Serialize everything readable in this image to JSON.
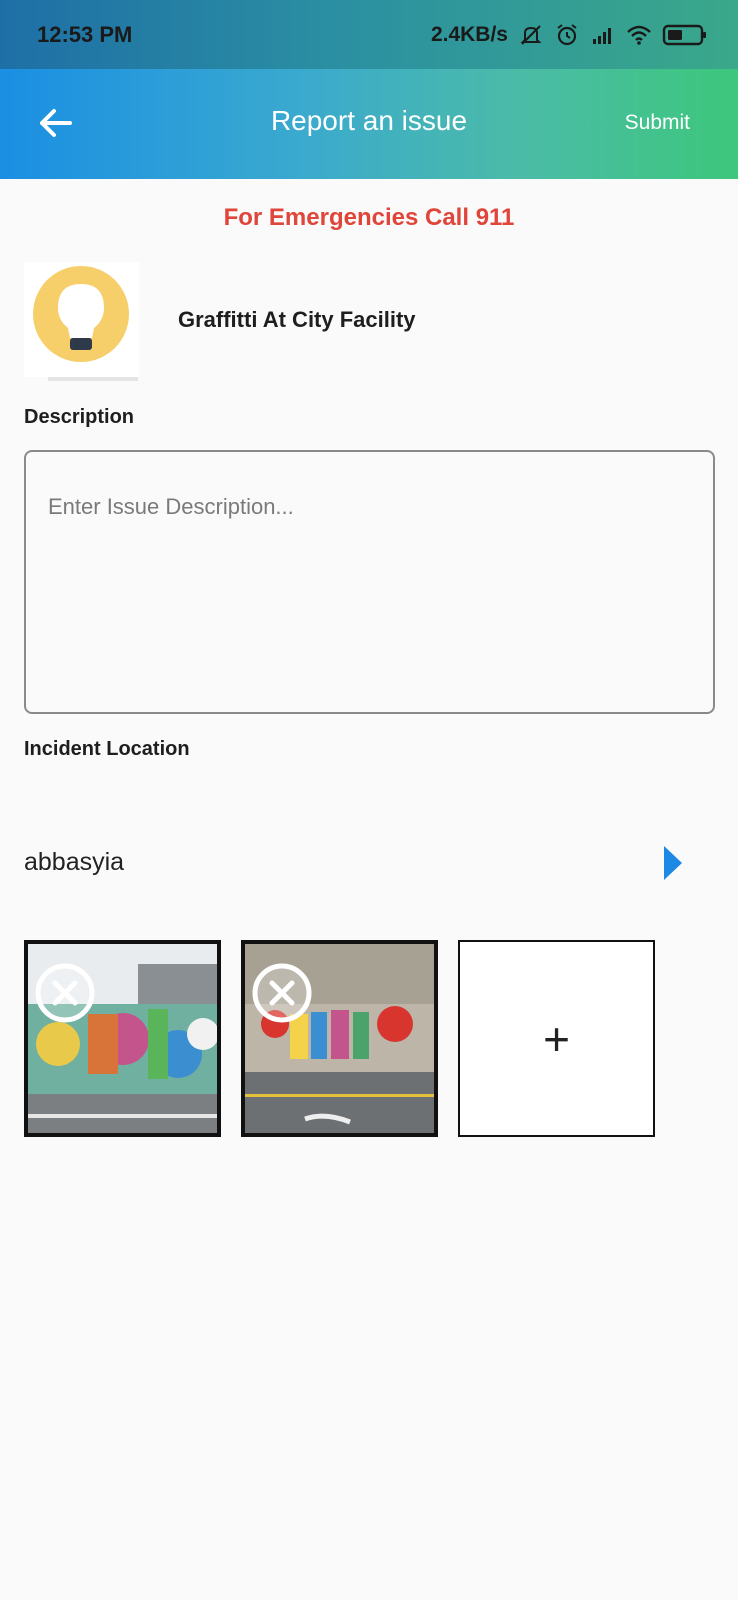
{
  "status_bar": {
    "time": "12:53 PM",
    "network_speed": "2.4KB/s",
    "icons": [
      "bell-muted-icon",
      "alarm-icon",
      "signal-icon",
      "wifi-icon",
      "battery-icon"
    ]
  },
  "app_bar": {
    "title": "Report an issue",
    "back_icon": "arrow-left-icon",
    "submit_label": "Submit",
    "gradient_colors": [
      "#1a8fe3",
      "#3dc77c"
    ]
  },
  "emergency_notice": "For Emergencies Call 911",
  "category": {
    "icon": "lightbulb-icon",
    "name": "Graffitti At City Facility"
  },
  "description": {
    "label": "Description",
    "placeholder": "Enter Issue Description...",
    "value": ""
  },
  "location": {
    "label": "Incident Location",
    "value": "abbasyia",
    "arrow_icon": "triangle-right-icon",
    "accent_color": "#1e88e5"
  },
  "photos": {
    "items": [
      {
        "alt": "graffiti wall photo 1",
        "remove_icon": "close-circle-icon"
      },
      {
        "alt": "graffiti wall photo 2",
        "remove_icon": "close-circle-icon"
      }
    ],
    "add_label": "+"
  }
}
